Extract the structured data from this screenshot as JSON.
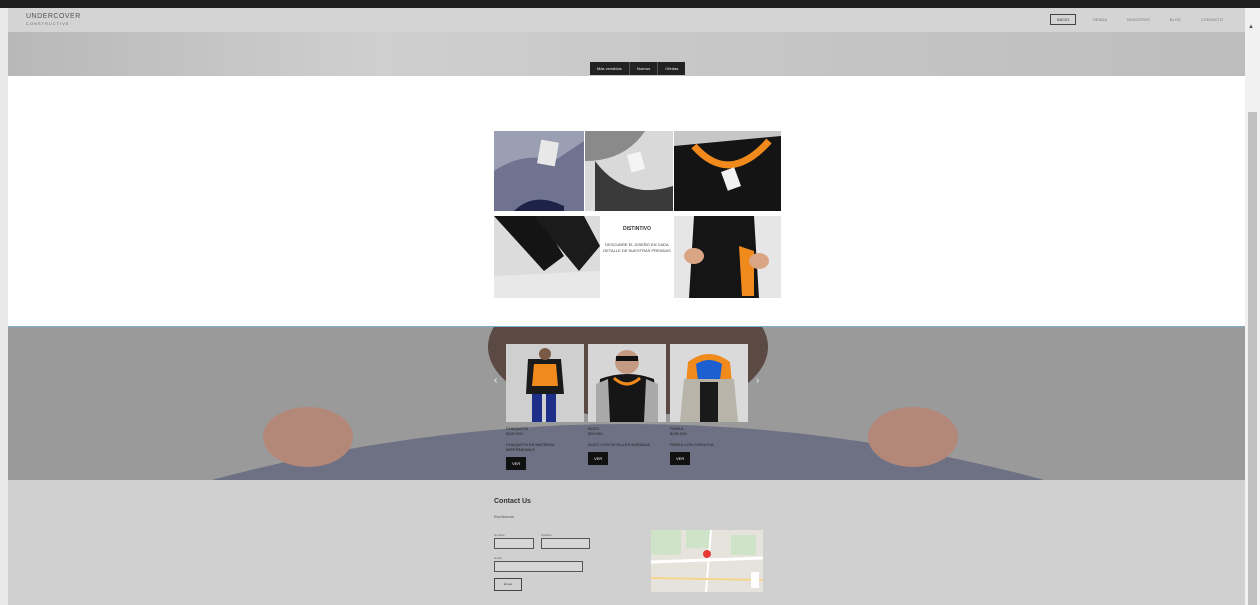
{
  "brand": {
    "name": "UNDERCOVER",
    "tagline": "CONSTRUCTIVE"
  },
  "nav": {
    "items": [
      "INICIO",
      "TIENDA",
      "NOSOTROS",
      "BLOG",
      "CONTACTO"
    ]
  },
  "tabs": [
    "Más vendidos",
    "Nuevos",
    "Ofertas"
  ],
  "promo": {
    "title": "DISTINTIVO",
    "text": "DESCUBRE EL DISEÑO EN CADA DETALLE DE NUESTRAS PRENDAS"
  },
  "products": [
    {
      "name": "CHAQUETA",
      "price": "$120.000",
      "desc": "CHAQUETA EN MATERIAL IMPERMEABLE",
      "button": "VER"
    },
    {
      "name": "BUZO",
      "price": "$95.000",
      "desc": "BUZO CON DETALLES NARANJA",
      "button": "VER"
    },
    {
      "name": "PARKA",
      "price": "$150.000",
      "desc": "PARKA CON CAPUCHA",
      "button": "VER"
    }
  ],
  "contact": {
    "title": "Contact Us",
    "subtitle": "Escríbenos",
    "first_name_label": "Nombre",
    "last_name_label": "Apellido",
    "email_label": "Email",
    "submit": "Enviar"
  },
  "colors": {
    "accent": "#f08a1c",
    "dark": "#111111"
  }
}
